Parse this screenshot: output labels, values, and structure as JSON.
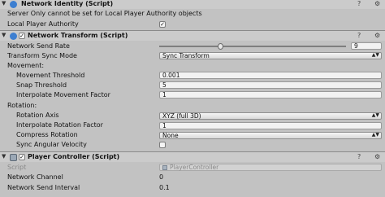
{
  "network_identity": {
    "title": "Network Identity (Script)",
    "warning": "Server Only cannot be set for Local Player Authority objects",
    "local_player_authority_label": "Local Player Authority",
    "local_player_authority_checked": true
  },
  "network_transform": {
    "title": "Network Transform (Script)",
    "enabled": true,
    "send_rate_label": "Network Send Rate",
    "send_rate_value": "9",
    "send_rate_slider_fraction": 0.33,
    "sync_mode_label": "Transform Sync Mode",
    "sync_mode_value": "Sync Transform",
    "movement_header": "Movement:",
    "movement_threshold_label": "Movement Threshold",
    "movement_threshold_value": "0.001",
    "snap_threshold_label": "Snap Threshold",
    "snap_threshold_value": "5",
    "interp_movement_label": "Interpolate Movement Factor",
    "interp_movement_value": "1",
    "rotation_header": "Rotation:",
    "rotation_axis_label": "Rotation Axis",
    "rotation_axis_value": "XYZ (full 3D)",
    "interp_rotation_label": "Interpolate Rotation Factor",
    "interp_rotation_value": "1",
    "compress_rotation_label": "Compress Rotation",
    "compress_rotation_value": "None",
    "sync_angular_label": "Sync Angular Velocity",
    "sync_angular_checked": false
  },
  "player_controller": {
    "title": "Player Controller (Script)",
    "enabled": true,
    "script_label": "Script",
    "script_value": "PlayerController",
    "channel_label": "Network Channel",
    "channel_value": "0",
    "interval_label": "Network Send Interval",
    "interval_value": "0.1"
  },
  "icons": {
    "foldout": "triangle-icon",
    "help": "help-icon",
    "gear": "gear-icon"
  }
}
